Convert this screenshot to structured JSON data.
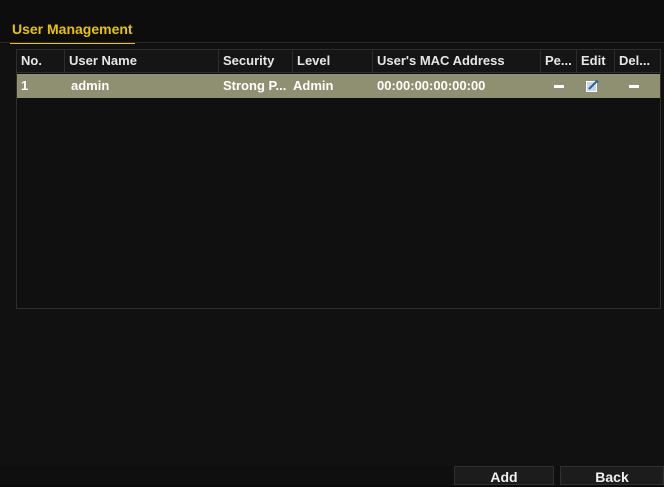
{
  "tab": {
    "label": "User Management"
  },
  "table": {
    "columns": [
      "No.",
      "User Name",
      "Security",
      "Level",
      "User's MAC Address",
      "Pe...",
      "Edit",
      "Del..."
    ],
    "rows": [
      {
        "no": "1",
        "user_name": "admin",
        "security": "Strong P...",
        "level": "Admin",
        "mac": "00:00:00:00:00:00",
        "permission": "dash",
        "edit": "edit-icon",
        "delete": "dash"
      }
    ]
  },
  "buttons": {
    "add": "Add",
    "back": "Back"
  },
  "colors": {
    "accent": "#e8c300",
    "selected_row": "#8f8f72",
    "background": "#111111"
  }
}
